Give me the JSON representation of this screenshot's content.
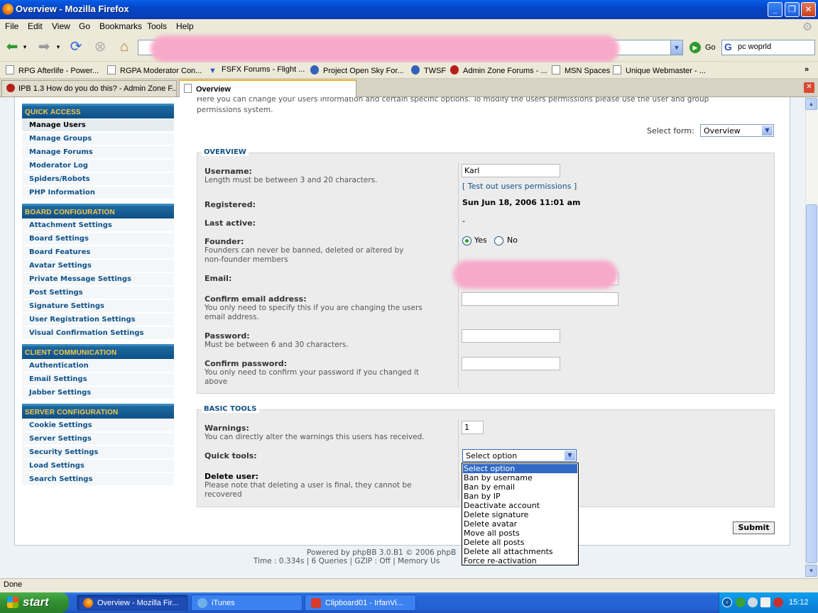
{
  "window": {
    "title": "Overview - Mozilla Firefox"
  },
  "menu": [
    "File",
    "Edit",
    "View",
    "Go",
    "Bookmarks",
    "Tools",
    "Help"
  ],
  "navbar": {
    "go_label": "Go",
    "search_value": "pc woprld"
  },
  "bookmarks": [
    "RPG Afterlife - Power...",
    "RGPA Moderator Con...",
    "FSFX Forums - Flight ...",
    "Project Open Sky For...",
    "TWSF",
    "Admin Zone Forums - ...",
    "MSN Spaces",
    "Unique Webmaster - ..."
  ],
  "tabs": [
    {
      "label": "IPB 1.3 How do you do this? - Admin Zone F...",
      "active": false
    },
    {
      "label": "Overview",
      "active": true
    }
  ],
  "intro": {
    "line1": "Here you can change your users information and certain specific options. To modify the users permissions please use the user and group",
    "line2": "permissions system."
  },
  "select_form": {
    "label": "Select form:",
    "value": "Overview"
  },
  "sidebar": {
    "sections": [
      {
        "title": "QUICK ACCESS",
        "items": [
          "Manage Users",
          "Manage Groups",
          "Manage Forums",
          "Moderator Log",
          "Spiders/Robots",
          "PHP Information"
        ]
      },
      {
        "title": "BOARD CONFIGURATION",
        "items": [
          "Attachment Settings",
          "Board Settings",
          "Board Features",
          "Avatar Settings",
          "Private Message Settings",
          "Post Settings",
          "Signature Settings",
          "User Registration Settings",
          "Visual Confirmation Settings"
        ]
      },
      {
        "title": "CLIENT COMMUNICATION",
        "items": [
          "Authentication",
          "Email Settings",
          "Jabber Settings"
        ]
      },
      {
        "title": "SERVER CONFIGURATION",
        "items": [
          "Cookie Settings",
          "Server Settings",
          "Security Settings",
          "Load Settings",
          "Search Settings"
        ]
      }
    ]
  },
  "overview": {
    "legend": "OVERVIEW",
    "username": {
      "label": "Username:",
      "hint": "Length must be between 3 and 20 characters.",
      "value": "Karl",
      "link_open": "[",
      "link": "Test out users permissions",
      "link_close": "]"
    },
    "registered": {
      "label": "Registered:",
      "value": "Sun Jun 18, 2006 11:01 am"
    },
    "last_active": {
      "label": "Last active:",
      "value": "-"
    },
    "founder": {
      "label": "Founder:",
      "hint1": "Founders can never be banned, deleted or altered by",
      "hint2": "non-founder members",
      "yes": "Yes",
      "no": "No",
      "selected": "Yes"
    },
    "email": {
      "label": "Email:"
    },
    "confirm_email": {
      "label": "Confirm email address:",
      "hint1": "You only need to specify this if you are changing the users",
      "hint2": "email address."
    },
    "password": {
      "label": "Password:",
      "hint": "Must be between 6 and 30 characters."
    },
    "confirm_password": {
      "label": "Confirm password:",
      "hint1": "You only need to confirm your password if you changed it",
      "hint2": "above"
    }
  },
  "basic_tools": {
    "legend": "BASIC TOOLS",
    "warnings": {
      "label": "Warnings:",
      "hint": "You can directly alter the warnings this users has received.",
      "value": "1"
    },
    "quick_tools": {
      "label": "Quick tools:",
      "value": "Select option",
      "options": [
        "Select option",
        "Ban by username",
        "Ban by email",
        "Ban by IP",
        "Deactivate account",
        "Delete signature",
        "Delete avatar",
        "Move all posts",
        "Delete all posts",
        "Delete all attachments",
        "Force re-activation"
      ]
    },
    "delete_user": {
      "label": "Delete user:",
      "hint1": "Please note that deleting a user is final, they cannot be",
      "hint2": "recovered"
    }
  },
  "submit_label": "Submit",
  "footer": {
    "line1": "Powered by phpBB 3.0.B1 © 2006 phpB",
    "line2": "Time : 0.334s | 6 Queries | GZIP : Off | Memory Us"
  },
  "status": "Done",
  "taskbar": {
    "start": "start",
    "tasks": [
      "Overview - Mozilla Fir...",
      "iTunes",
      "Clipboard01 - IrfanVi..."
    ],
    "clock": "15:12"
  }
}
